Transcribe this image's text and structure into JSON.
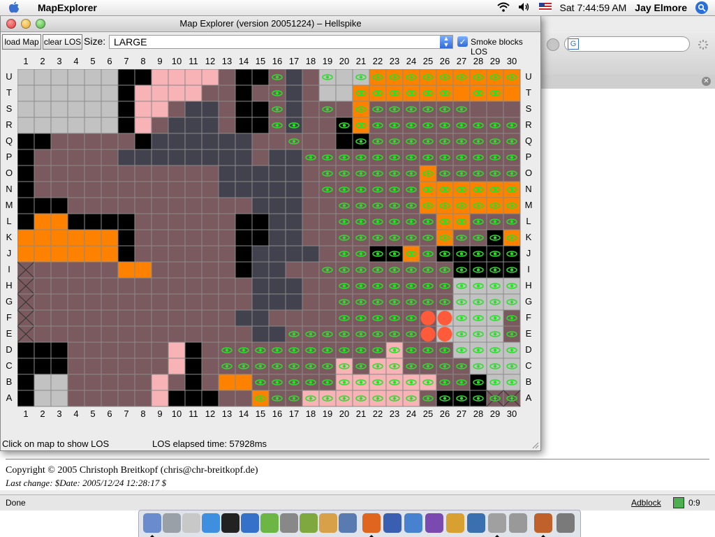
{
  "menubar": {
    "app_name": "MapExplorer",
    "clock": "Sat 7:44:59 AM",
    "user": "Jay Elmore",
    "icons": [
      "apple-icon",
      "wifi-icon",
      "volume-icon",
      "flag-icon",
      "spotlight-icon"
    ]
  },
  "window": {
    "title": "Map Explorer (version 20051224) – Hellspike",
    "load_button": "load Map",
    "clear_button": "clear LOS",
    "size_label": "Size:",
    "size_value": "LARGE",
    "smoke_label": "Smoke blocks LOS",
    "smoke_checked": true,
    "status_left": "Click on map to show LOS",
    "status_right": "LOS elapsed time: 57928ms"
  },
  "grid": {
    "columns": [
      "1",
      "2",
      "3",
      "4",
      "5",
      "6",
      "7",
      "8",
      "9",
      "10",
      "11",
      "12",
      "13",
      "14",
      "15",
      "16",
      "17",
      "18",
      "19",
      "20",
      "21",
      "22",
      "23",
      "24",
      "25",
      "26",
      "27",
      "28",
      "29",
      "30"
    ],
    "rows": [
      "U",
      "T",
      "S",
      "R",
      "Q",
      "P",
      "O",
      "N",
      "M",
      "L",
      "K",
      "J",
      "I",
      "H",
      "G",
      "F",
      "E",
      "D",
      "C",
      "B",
      "A"
    ],
    "palette": {
      ".": "#7a5a5e",
      "#": "#000000",
      "g": "#c2c2c2",
      "k": "#f7b3b6",
      "o": "#ff8100",
      "d": "#42424e",
      "c": "#1ff5ff",
      "x": "#7a5a5e"
    },
    "line_color": "#8a8a8a",
    "eye_color": "#28e028",
    "marker_color": "#ff5a3a",
    "cells": [
      "gggggg##kkkk.##.d.gggooooooooooo",
      "gggggg#kkkk..#..d.ggoooooooooooo",
      "gggggg#kk.dd.##.d...o.........co",
      "gggggg#k.ddd.##.d..#o.........c.",
      "##.....#dddddd.....##.........#",
      "#.....dddddddd.dd..............",
      "#...........ddddd.......o......",
      "#...........ddddd.......oooooo",
      "###...........ddd.......oooooo",
      "#oo####......##dd........oo...o",
      "oooooo#......##dd........o..#o",
      "oooooo#......#dddd...##o.#####",
      "x.....oo.....#dd..........####",
      "x.............ddd.........gggg",
      "x.............ddd.........gggg",
      "x............dd..........gggg",
      "x.............dd.........gggg",
      "###......k#...........k...gggg",
      "###......k#........k.kk....gggx",
      "#gg.....k.#.oo.....kkkkkk..#ggx",
      "#gg.....k###..o..kkkkkkk.###xxx"
    ],
    "eyes": [
      "...............e..e.eeeeeeeeeee",
      "...............e....eeeeee.ee.e",
      "...............e..e.eeeeeee....",
      "...............ee..eeeeeeeeeeee",
      "................e...eeeeeeeeeee",
      ".................eeeeeeeeeeeeee",
      "..................eeeeeeeeeeeee",
      "..................eeeeeeeeeeeee",
      "...................eeeeeeeeeeee",
      "...................eeeeeeeeeeee",
      "...................eeeeeeeeeeee",
      "...................eeeeeeeeeeee",
      "..................eeeeeeeeeeeee",
      "...................eeeeeeeeeeee",
      "...................eeeeeeeeeeee",
      "...................eeeeeeeeeeee",
      "................eeeeeeeeeeeeeee",
      "............eeeeeeeeeeeeeeeeeee",
      "............eeeeeeeeeeeeeeeeeee",
      "..............eeeeeeeeeeeeeeeee",
      "..............eeeeeeeeeeeeeeeee"
    ],
    "markers": [
      [
        15,
        24
      ],
      [
        15,
        25
      ],
      [
        16,
        24
      ],
      [
        16,
        25
      ]
    ]
  },
  "browser": {
    "copyright": "Copyright © 2005 Christoph Breitkopf (chris@chr-breitkopf.de)",
    "last_change": "Last change: $Date: 2005/12/24 12:28:17 $",
    "status": "Done",
    "adblock": "Adblock",
    "download_count": "0:9"
  }
}
